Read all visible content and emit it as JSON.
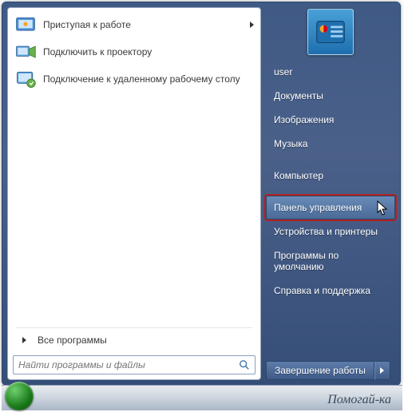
{
  "left": {
    "programs": [
      {
        "label": "Приступая к работе",
        "icon": "getting-started",
        "has_submenu": true
      },
      {
        "label": "Подключить к проектору",
        "icon": "projector",
        "has_submenu": false
      },
      {
        "label": "Подключение к удаленному рабочему столу",
        "icon": "remote-desktop",
        "has_submenu": false
      }
    ],
    "all_programs_label": "Все программы",
    "search_placeholder": "Найти программы и файлы"
  },
  "right": {
    "user": "user",
    "items": [
      {
        "label": "Документы"
      },
      {
        "label": "Изображения"
      },
      {
        "label": "Музыка"
      },
      {
        "label": "Компьютер"
      },
      {
        "label": "Панель управления",
        "highlighted": true
      },
      {
        "label": "Устройства и принтеры"
      },
      {
        "label": "Программы по умолчанию"
      },
      {
        "label": "Справка и поддержка"
      }
    ],
    "shutdown_label": "Завершение работы"
  },
  "watermark": "Помогай-ка"
}
